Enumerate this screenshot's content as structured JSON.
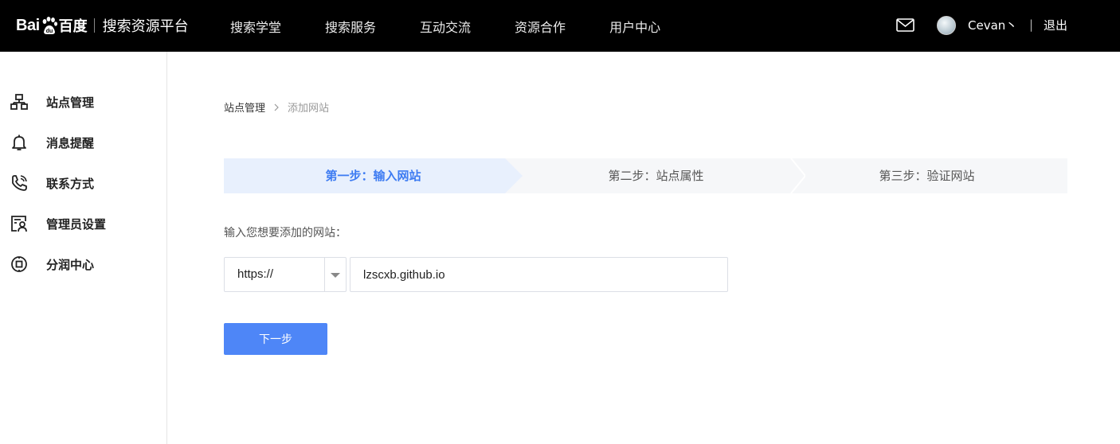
{
  "header": {
    "logo_bai": "Bai",
    "logo_du": "百度",
    "platform": "搜索资源平台",
    "nav": [
      "搜索学堂",
      "搜索服务",
      "互动交流",
      "资源合作",
      "用户中心"
    ],
    "username": "Cevan丶",
    "separator": "|",
    "logout": "退出",
    "mail_icon": "mail-icon"
  },
  "sidebar": {
    "items": [
      {
        "label": "站点管理",
        "icon": "sitemap-icon"
      },
      {
        "label": "消息提醒",
        "icon": "bell-icon"
      },
      {
        "label": "联系方式",
        "icon": "phone-icon"
      },
      {
        "label": "管理员设置",
        "icon": "admin-icon"
      },
      {
        "label": "分润中心",
        "icon": "revenue-icon"
      }
    ]
  },
  "breadcrumb": {
    "parent": "站点管理",
    "current": "添加网站"
  },
  "steps": [
    {
      "label": "第一步：输入网站",
      "active": true
    },
    {
      "label": "第二步：站点属性",
      "active": false
    },
    {
      "label": "第三步：验证网站",
      "active": false
    }
  ],
  "form": {
    "prompt": "输入您想要添加的网站：",
    "protocol": "https://",
    "site_value": "lzscxb.github.io",
    "next_label": "下一步"
  },
  "colors": {
    "topbar": "#000000",
    "accent": "#4e86f7",
    "active_step_bg": "#e8f0fd",
    "active_step_text": "#3e7cf2"
  }
}
